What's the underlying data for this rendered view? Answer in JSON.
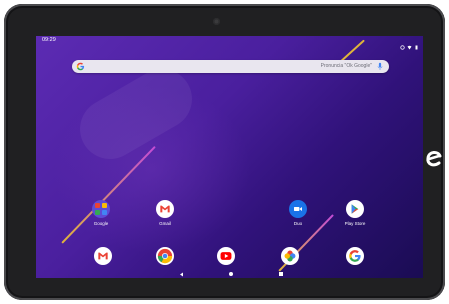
{
  "status_bar": {
    "time": "09:29"
  },
  "search": {
    "placeholder": "Pronuncia \"Ok Google\""
  },
  "home_apps": [
    {
      "label": "Google"
    },
    {
      "label": "Gmail"
    },
    {
      "label": "Duo"
    },
    {
      "label": "Play Store"
    }
  ],
  "dock_apps": [
    "Gmail",
    "Chrome",
    "YouTube",
    "Photos",
    "Google"
  ],
  "navigation": [
    "back",
    "home",
    "recents"
  ],
  "colors": {
    "wallpaper_top": "#5c2bb3",
    "wallpaper_bottom": "#1a0c53",
    "accent_line": "#e0b43a",
    "accent_line_2": "#c34bd6"
  }
}
